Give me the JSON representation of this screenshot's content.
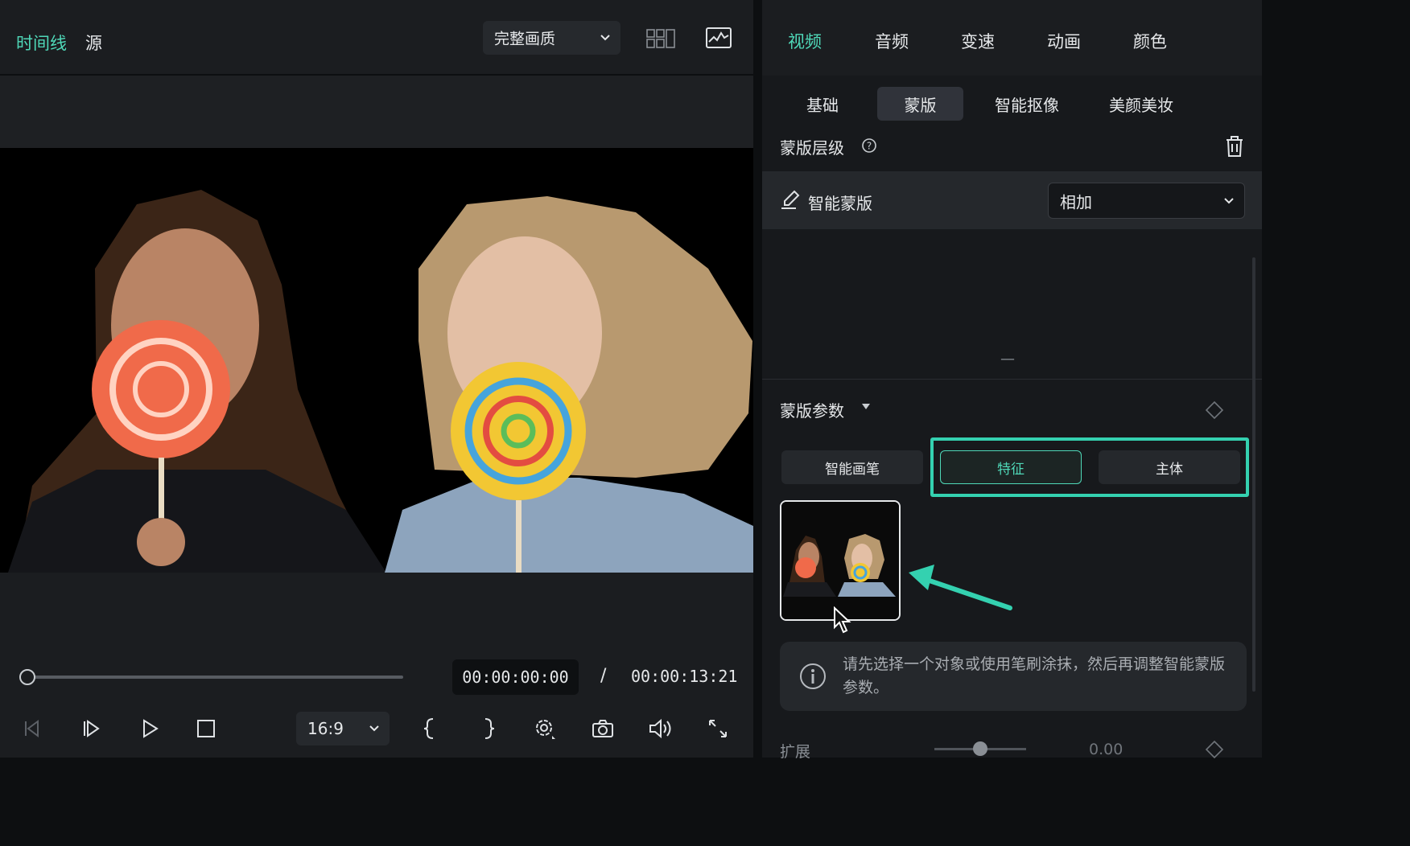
{
  "player": {
    "tabs": [
      "时间线",
      "源"
    ],
    "quality": "完整画质",
    "current_time": "00:00:00:00",
    "separator": "/",
    "total_time": "00:00:13:21",
    "aspect_ratio": "16:9",
    "playhead_progress": 0
  },
  "inspector": {
    "main_tabs": [
      "视频",
      "音频",
      "变速",
      "动画",
      "颜色"
    ],
    "sub_tabs": [
      "基础",
      "蒙版",
      "智能抠像",
      "美颜美妆"
    ],
    "mask_layer_title": "蒙版层级",
    "smart_mask_label": "智能蒙版",
    "blend_mode": "相加",
    "collapsed_indicator": "—",
    "mask_params_title": "蒙版参数",
    "mode_buttons": [
      "智能画笔",
      "特征",
      "主体"
    ],
    "info_text": "请先选择一个对象或使用笔刷涂抹，然后再调整智能蒙版参数。",
    "expand_label": "扩展",
    "expand_value": "0.00",
    "expand_slider_value": 0.5
  },
  "colors": {
    "accent": "#4fd8b8",
    "highlight_box": "#34d1b0"
  },
  "icons": [
    "chevron-down-icon",
    "grid-view-icon",
    "waveform-image-icon",
    "help-icon",
    "trash-icon",
    "brush-icon",
    "diamond-keyframe-icon",
    "info-icon",
    "arrow-icon",
    "cursor-icon",
    "step-back-icon",
    "step-forward-icon",
    "play-icon",
    "stop-icon",
    "mark-in-icon",
    "mark-out-icon",
    "settings-icon",
    "camera-icon",
    "volume-icon",
    "fullscreen-icon"
  ]
}
